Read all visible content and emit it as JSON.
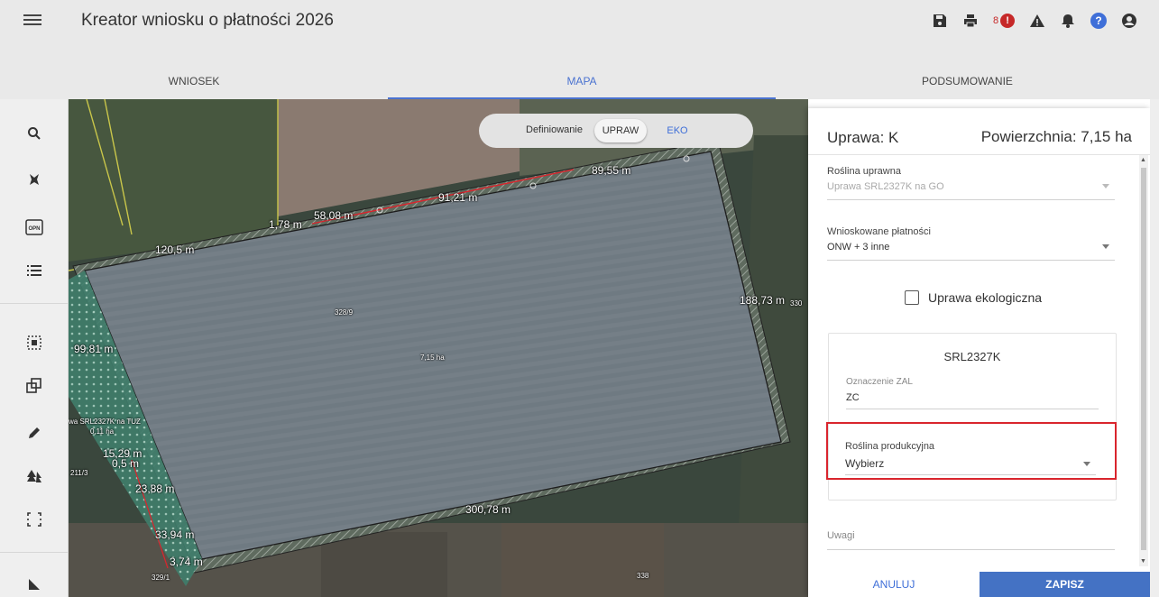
{
  "app": {
    "title": "Kreator wniosku o płatności 2026",
    "toolbar": {
      "error_count": "8",
      "error_mark": "!",
      "help_mark": "?",
      "icons": [
        "save-icon",
        "print-icon",
        "error-icon",
        "warning-icon",
        "bell-icon",
        "help-icon",
        "user-icon"
      ]
    }
  },
  "tabs": [
    {
      "label": "WNIOSEK",
      "active": false
    },
    {
      "label": "MAPA",
      "active": true
    },
    {
      "label": "PODSUMOWANIE",
      "active": false
    }
  ],
  "sidebar": {
    "icons": [
      "search-icon",
      "tool-icon",
      "opn-icon",
      "list-icon",
      "select-area-icon",
      "copy-icon",
      "pencil-icon",
      "trees-icon",
      "frame-icon",
      "measure-icon"
    ],
    "opn_text": "OPN"
  },
  "map": {
    "toggle": {
      "label": "Definiowanie",
      "option_upraw": "UPRAW",
      "option_eko": "EKO"
    },
    "labels": {
      "m_89": "89,55 m",
      "m_91": "91,21 m",
      "m_58": "58,08 m",
      "m_1": "1,78 m",
      "m_120": "120,5 m",
      "m_188": "188,73 m",
      "m_99": "99,81 m",
      "m_300": "300,78 m",
      "m_23": "23,88 m",
      "m_33": "33,94 m",
      "m_3": "3,74 m",
      "m_15": "15,29 m",
      "m_0": "0,5 m",
      "n_328_9": "328/9",
      "n_328_1": "329/1",
      "n_338": "338",
      "n_330": "330",
      "n_211_3": "211/3",
      "n_area": "7,15 ha",
      "n_side": "wa SRL2327K na TUZ",
      "n_side2": "0,11 ha"
    }
  },
  "panel": {
    "title": "Uprawa: K",
    "area": "Powierzchnia: 7,15 ha",
    "roslina_uprawna": {
      "label": "Roślina uprawna",
      "value": "Uprawa SRL2327K na GO"
    },
    "platnosci": {
      "label": "Wnioskowane płatności",
      "value": "ONW + 3 inne"
    },
    "ekologiczna": {
      "label": "Uprawa ekologiczna",
      "checked": false
    },
    "card": {
      "title": "SRL2327K",
      "zal_label": "Oznaczenie ZAL",
      "zal_value": "ZC",
      "prod_label": "Roślina produkcyjna",
      "prod_value": "Wybierz"
    },
    "uwagi": "Uwagi",
    "cancel": "ANULUJ",
    "save": "ZAPISZ"
  },
  "colors": {
    "accent": "#4472c4",
    "highlight": "#d9252d",
    "error": "#c62828"
  }
}
